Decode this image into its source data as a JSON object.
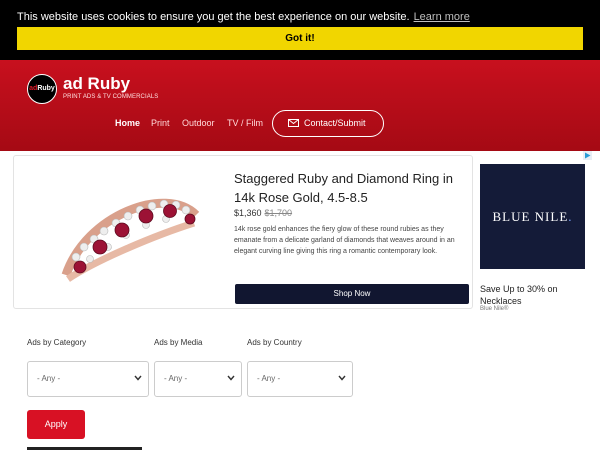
{
  "cookie": {
    "message": "This website uses cookies to ensure you get the best experience on our website.",
    "link_label": "Learn more",
    "button_label": "Got it!"
  },
  "header": {
    "brand_name": "ad Ruby",
    "tagline": "PRINT ADS & TV COMMERCIALS",
    "nav": [
      {
        "label": "Home",
        "active": true
      },
      {
        "label": "Print",
        "active": false
      },
      {
        "label": "Outdoor",
        "active": false
      },
      {
        "label": "TV / Film",
        "active": false
      }
    ],
    "contact_label": "Contact/Submit"
  },
  "ad": {
    "title": "Staggered Ruby and Diamond Ring in 14k Rose Gold, 4.5-8.5",
    "price": "$1,360",
    "old_price": "$1,700",
    "description": "14k rose gold enhances the fiery glow of these round rubies as they emanate from a delicate garland of diamonds that weaves around in an elegant curving line giving this ring a romantic contemporary look.",
    "cta_label": "Shop Now"
  },
  "side_ad": {
    "banner_text": "BLUE NILE",
    "banner_dot": ".",
    "text": "Save Up to 30% on Necklaces",
    "source": "Blue Nile®"
  },
  "filters": {
    "category_label": "Ads by Category",
    "media_label": "Ads by Media",
    "country_label": "Ads by Country",
    "category_value": "- Any -",
    "media_value": "- Any -",
    "country_value": "- Any -",
    "apply_label": "Apply"
  },
  "colors": {
    "cookie_button": "#f1d600",
    "header_red": "#c8101e",
    "shop_button": "#111630",
    "apply_button": "#d81124",
    "ruby": "#9c1235",
    "rose_gold": "#d9a08b"
  }
}
